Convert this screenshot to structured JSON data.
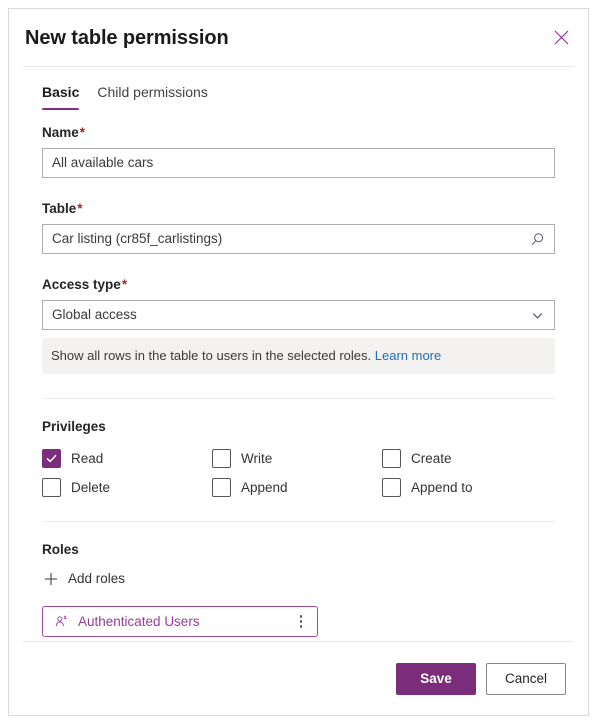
{
  "dialog": {
    "title": "New table permission",
    "close_icon": "close-icon"
  },
  "tabs": [
    {
      "label": "Basic",
      "active": true
    },
    {
      "label": "Child permissions",
      "active": false
    }
  ],
  "fields": {
    "name": {
      "label": "Name",
      "required_marker": "*",
      "value": "All available cars",
      "placeholder": ""
    },
    "table": {
      "label": "Table",
      "required_marker": "*",
      "value": "Car listing (cr85f_carlistings)",
      "placeholder": "",
      "trailing_icon": "search-icon"
    },
    "access_type": {
      "label": "Access type",
      "required_marker": "*",
      "value": "Global access",
      "trailing_icon": "chevron-down-icon",
      "options": [
        "Global access"
      ]
    }
  },
  "info_banner": {
    "text": "Show all rows in the table to users in the selected roles.",
    "link_label": "Learn more"
  },
  "privileges": {
    "title": "Privileges",
    "items": [
      {
        "label": "Read",
        "checked": true
      },
      {
        "label": "Write",
        "checked": false
      },
      {
        "label": "Create",
        "checked": false
      },
      {
        "label": "Delete",
        "checked": false
      },
      {
        "label": "Append",
        "checked": false
      },
      {
        "label": "Append to",
        "checked": false
      }
    ]
  },
  "roles": {
    "title": "Roles",
    "add_label": "Add roles",
    "add_icon": "plus-icon",
    "chips": [
      {
        "label": "Authenticated Users",
        "icon": "person-icon",
        "menu_icon": "more-vertical-icon"
      }
    ]
  },
  "footer": {
    "save_label": "Save",
    "cancel_label": "Cancel"
  },
  "colors": {
    "accent_purple": "#7b2d7b",
    "chip_purple": "#9a3d9a",
    "required_red": "#a4262c",
    "link_blue": "#1f6fb5",
    "banner_bg": "#f3f2f1"
  }
}
